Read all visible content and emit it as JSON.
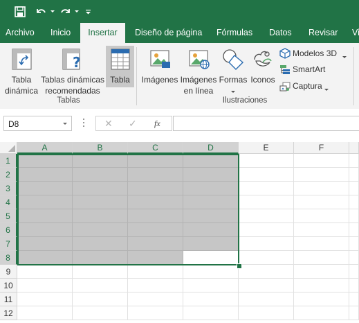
{
  "qat": {
    "save_icon": "save-icon",
    "undo_icon": "undo-icon",
    "redo_icon": "redo-icon",
    "customize_icon": "customize-qat-icon"
  },
  "tabs": [
    "Archivo",
    "Inicio",
    "Insertar",
    "Diseño de página",
    "Fórmulas",
    "Datos",
    "Revisar",
    "Vi"
  ],
  "active_tab": "Insertar",
  "ribbon": {
    "tablas_group": {
      "label": "Tablas",
      "tabla_dinamica": [
        "Tabla",
        "dinámica"
      ],
      "tablas_recomendadas": [
        "Tablas dinámicas",
        "recomendadas"
      ],
      "tabla": "Tabla"
    },
    "ilustraciones_group": {
      "label": "Ilustraciones",
      "imagenes": "Imágenes",
      "imagenes_linea": [
        "Imágenes",
        "en línea"
      ],
      "formas": "Formas",
      "iconos": "Iconos",
      "modelos_3d": "Modelos 3D",
      "smartart": "SmartArt",
      "captura": "Captura"
    }
  },
  "formula_bar": {
    "name_box": "D8",
    "cancel_symbol": "✕",
    "enter_symbol": "✓",
    "fx_symbol": "fx",
    "formula_value": ""
  },
  "sheet": {
    "columns": [
      "A",
      "B",
      "C",
      "D",
      "E",
      "F"
    ],
    "rows": [
      "1",
      "2",
      "3",
      "4",
      "5",
      "6",
      "7",
      "8",
      "9",
      "10",
      "11",
      "12"
    ],
    "selection": "A1:D8",
    "active_cell": "D8"
  },
  "colors": {
    "brand_green": "#217346",
    "ribbon_bg": "#f3f3f3",
    "selection_fill": "#c6c6c6"
  }
}
